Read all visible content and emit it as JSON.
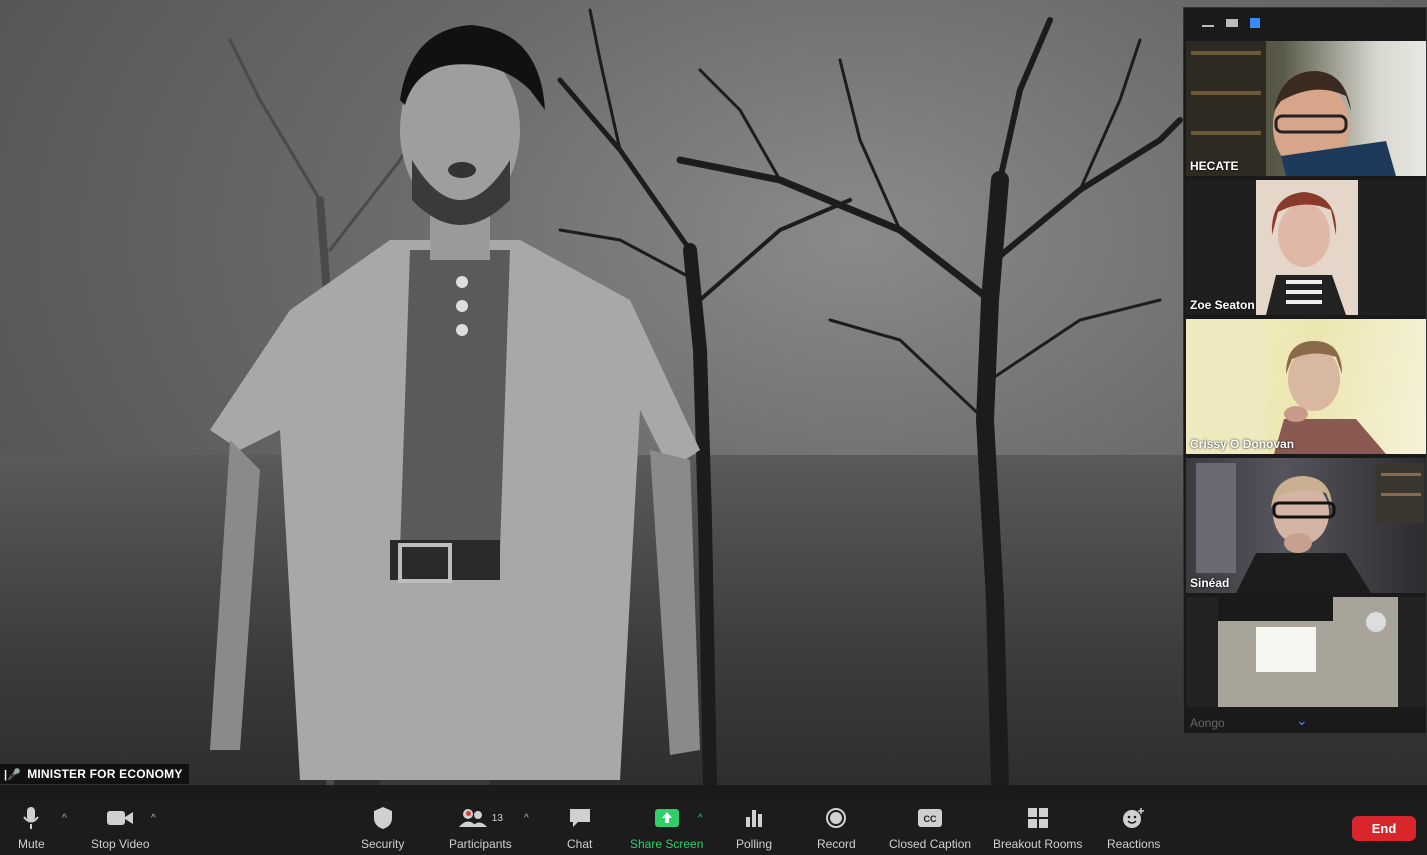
{
  "stage": {
    "speaker_label": "MINISTER FOR ECONOMY"
  },
  "gallery": {
    "participants": [
      {
        "name": "HECATE"
      },
      {
        "name": "Zoe Seaton"
      },
      {
        "name": "Crissy O Donovan"
      },
      {
        "name": "Sinéad"
      },
      {
        "name": ""
      }
    ],
    "next_name": "Aongo"
  },
  "toolbar": {
    "mute_label": "Mute",
    "stop_video_label": "Stop Video",
    "security_label": "Security",
    "participants_label": "Participants",
    "participants_count": "13",
    "chat_label": "Chat",
    "share_screen_label": "Share Screen",
    "polling_label": "Polling",
    "record_label": "Record",
    "closed_caption_label": "Closed Caption",
    "breakout_rooms_label": "Breakout Rooms",
    "reactions_label": "Reactions",
    "end_label": "End"
  },
  "colors": {
    "accent_blue": "#3a8bff",
    "share_green": "#2fd06a",
    "end_red": "#d9262d"
  }
}
